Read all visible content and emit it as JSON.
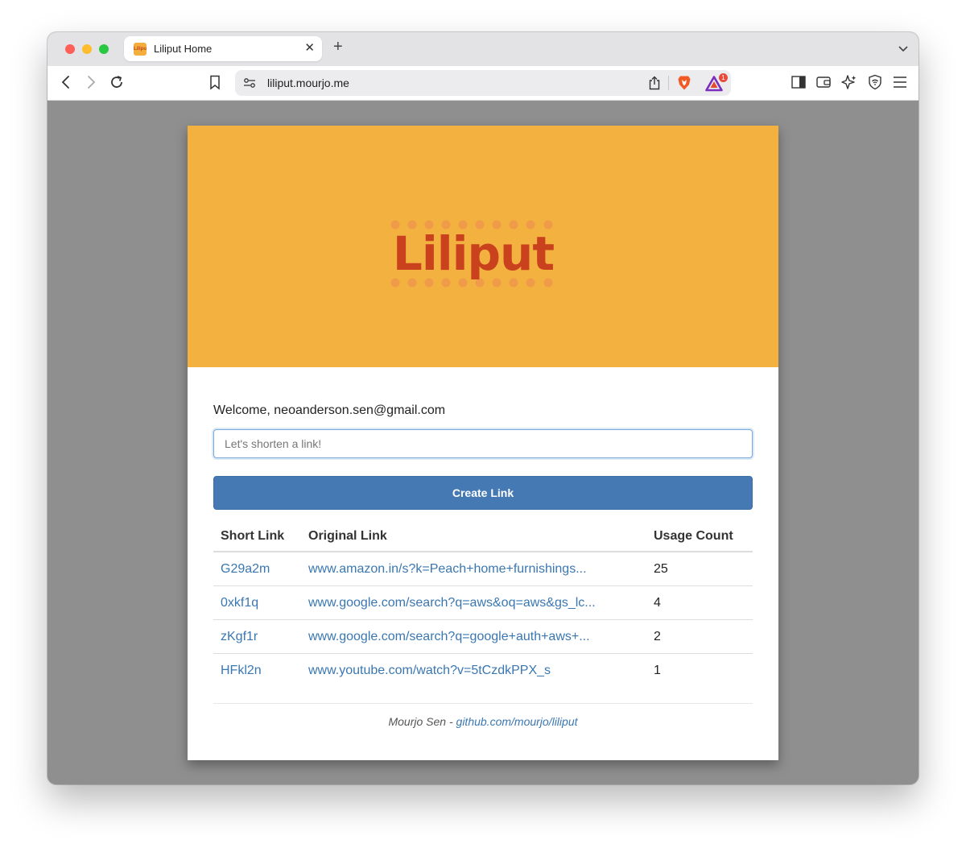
{
  "browser": {
    "tab_title": "Liliput Home",
    "favicon_text": "Liliput",
    "url": "liliput.mourjo.me",
    "notification_count": "1",
    "icons": [
      "back-icon",
      "forward-icon",
      "reload-icon",
      "bookmark-icon",
      "site-settings-icon",
      "share-icon",
      "brave-shields-icon",
      "brave-rewards-icon",
      "sidebar-icon",
      "wallet-icon",
      "leo-ai-icon",
      "vpn-icon",
      "menu-icon"
    ]
  },
  "page": {
    "logo_text": "Liliput",
    "welcome": "Welcome, neoanderson.sen@gmail.com",
    "input_placeholder": "Let's shorten a link!",
    "create_button": "Create Link",
    "table": {
      "headers": [
        "Short Link",
        "Original Link",
        "Usage Count"
      ],
      "rows": [
        {
          "short": "G29a2m",
          "original": "www.amazon.in/s?k=Peach+home+furnishings...",
          "count": "25"
        },
        {
          "short": "0xkf1q",
          "original": "www.google.com/search?q=aws&oq=aws&gs_lc...",
          "count": "4"
        },
        {
          "short": "zKgf1r",
          "original": "www.google.com/search?q=google+auth+aws+...",
          "count": "2"
        },
        {
          "short": "HFkl2n",
          "original": "www.youtube.com/watch?v=5tCzdkPPX_s",
          "count": "1"
        }
      ]
    },
    "footer": {
      "author": "Mourjo Sen -",
      "link": "github.com/mourjo/liliput"
    }
  },
  "colors": {
    "hero": "#f3b140",
    "logo": "#c9421d",
    "button": "#4479b3",
    "link": "#3a77b2",
    "viewport": "#8f8f8f"
  }
}
